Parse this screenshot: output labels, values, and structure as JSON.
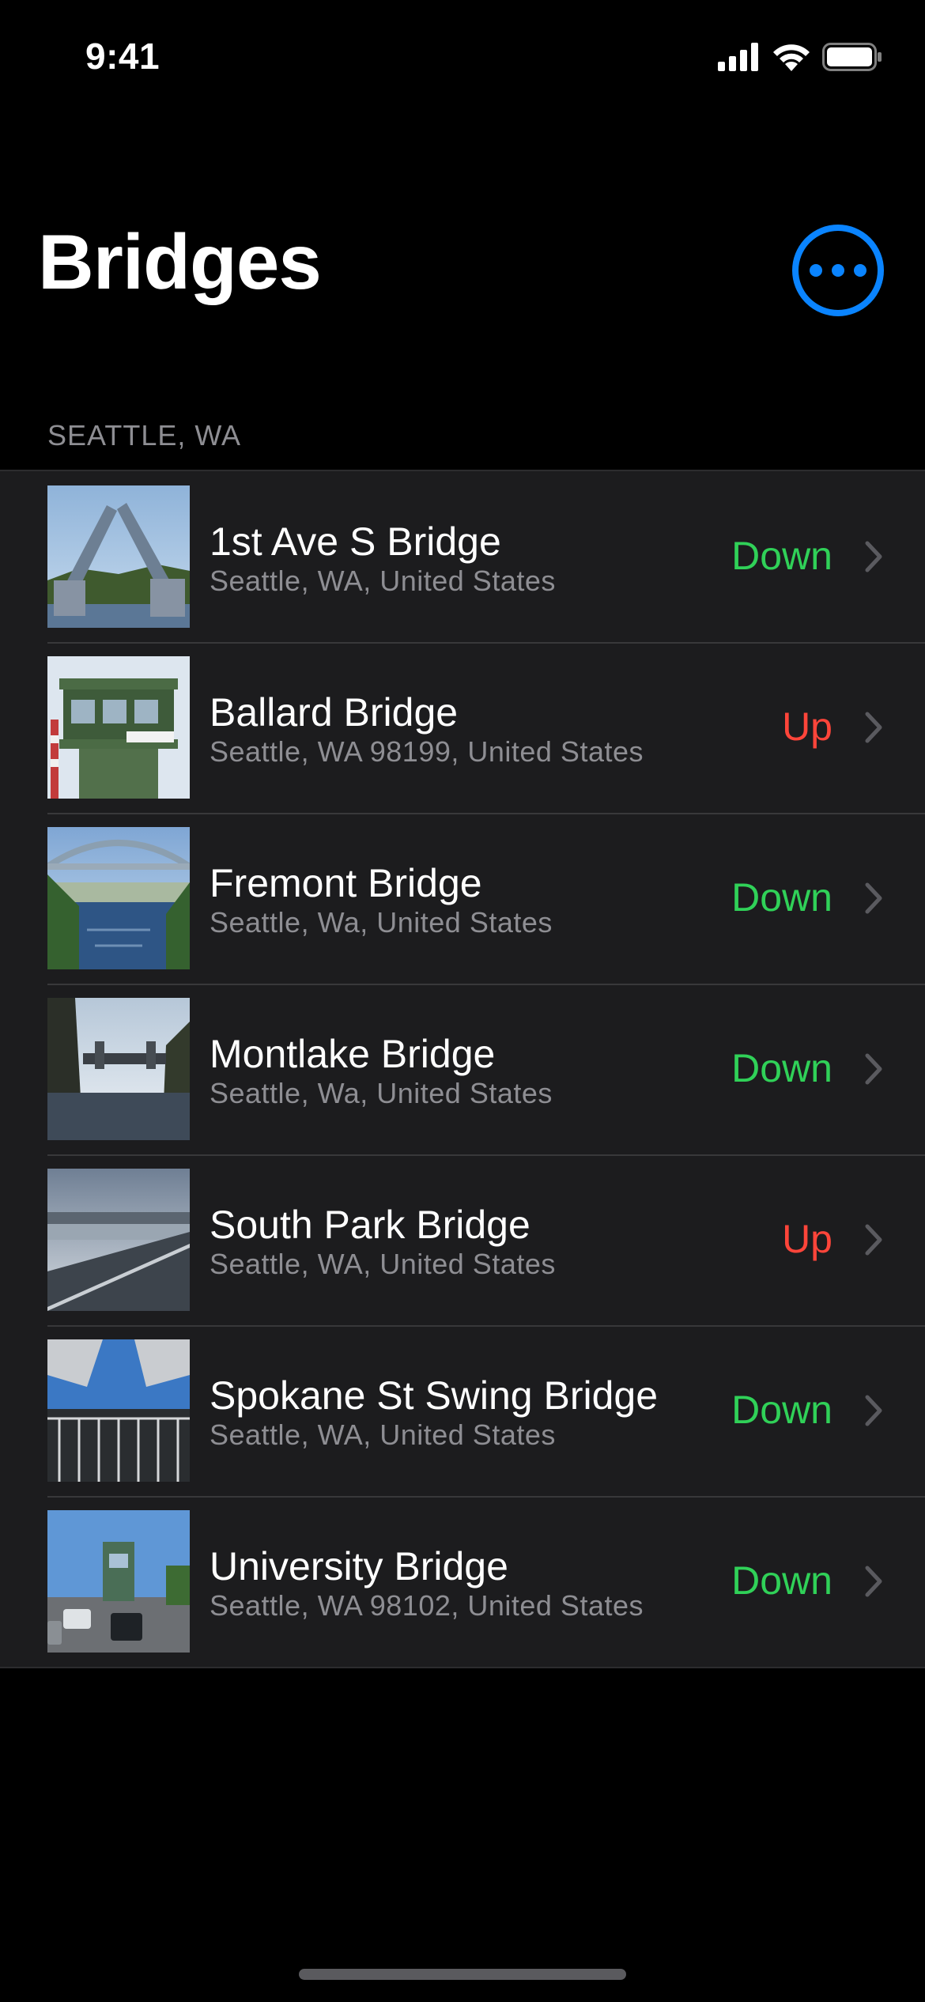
{
  "status_bar": {
    "time": "9:41",
    "icons": [
      "cellular-signal-icon",
      "wifi-icon",
      "battery-icon"
    ]
  },
  "header": {
    "title": "Bridges",
    "more_button_icon": "ellipsis-circle-icon"
  },
  "section": {
    "header": "SEATTLE, WA"
  },
  "colors": {
    "accent": "#0a84ff",
    "status_down": "#30d158",
    "status_up": "#ff453a",
    "row_background": "#1c1c1e",
    "secondary_text": "#8e8e93"
  },
  "bridges": [
    {
      "name": "1st Ave S Bridge",
      "location": "Seattle, WA, United States",
      "status": "Down",
      "status_state": "down",
      "photo": "bascule-bridge-raised-photo"
    },
    {
      "name": "Ballard Bridge",
      "location": "Seattle, WA 98199, United States",
      "status": "Up",
      "status_state": "up",
      "photo": "bridge-control-tower-photo"
    },
    {
      "name": "Fremont Bridge",
      "location": "Seattle, Wa, United States",
      "status": "Down",
      "status_state": "down",
      "photo": "canal-arch-bridge-photo"
    },
    {
      "name": "Montlake Bridge",
      "location": "Seattle, Wa, United States",
      "status": "Down",
      "status_state": "down",
      "photo": "montlake-cut-bridge-photo"
    },
    {
      "name": "South Park Bridge",
      "location": "Seattle, WA, United States",
      "status": "Up",
      "status_state": "up",
      "photo": "south-park-bridge-deck-photo"
    },
    {
      "name": "Spokane St Swing Bridge",
      "location": "Seattle, WA, United States",
      "status": "Down",
      "status_state": "down",
      "photo": "swing-bridge-underside-photo"
    },
    {
      "name": "University Bridge",
      "location": "Seattle, WA  98102, United States",
      "status": "Down",
      "status_state": "down",
      "photo": "university-bridge-traffic-photo"
    }
  ]
}
